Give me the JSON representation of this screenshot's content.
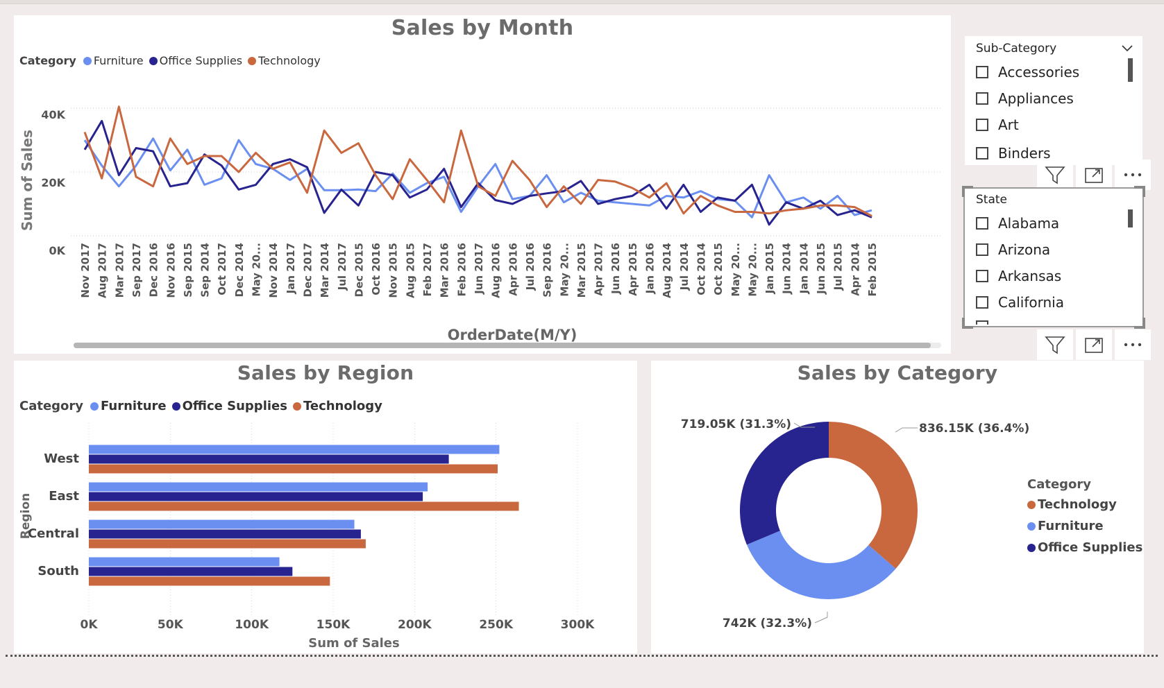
{
  "colors": {
    "furniture": "#6b8ff0",
    "office_supplies": "#27238f",
    "technology": "#c9683f"
  },
  "month_chart": {
    "title": "Sales by Month",
    "legend_label": "Category",
    "legend": [
      "Furniture",
      "Office Supplies",
      "Technology"
    ],
    "ylabel": "Sum of Sales",
    "xlabel": "OrderDate(M/Y)",
    "y_ticks": [
      "40K",
      "20K",
      "0K"
    ]
  },
  "region_chart": {
    "title": "Sales by Region",
    "legend_label": "Category",
    "legend": [
      "Furniture",
      "Office Supplies",
      "Technology"
    ],
    "ylabel": "Region",
    "xlabel": "Sum of Sales",
    "x_ticks": [
      "0K",
      "50K",
      "100K",
      "150K",
      "200K",
      "250K",
      "300K"
    ]
  },
  "category_chart": {
    "title": "Sales by Category",
    "legend_title": "Category",
    "legend": [
      "Technology",
      "Furniture",
      "Office Supplies"
    ],
    "labels": [
      "836.15K (36.4%)",
      "742K (32.3%)",
      "719.05K (31.3%)"
    ]
  },
  "slicers": {
    "subcategory": {
      "header": "Sub-Category",
      "items": [
        "Accessories",
        "Appliances",
        "Art",
        "Binders"
      ]
    },
    "state": {
      "header": "State",
      "items": [
        "Alabama",
        "Arizona",
        "Arkansas",
        "California"
      ]
    }
  },
  "chart_data": [
    {
      "type": "line",
      "title": "Sales by Month",
      "xlabel": "OrderDate(M/Y)",
      "ylabel": "Sum of Sales",
      "ylim": [
        0,
        45000
      ],
      "grid": true,
      "legend_placement": "top-left",
      "categories": [
        "Nov 2017",
        "Aug 2017",
        "Mar 2017",
        "Sep 2017",
        "Dec 2016",
        "Nov 2016",
        "Sep 2015",
        "Sep 2014",
        "Oct 2017",
        "Dec 2014",
        "May 20...",
        "Nov 2014",
        "Jan 2017",
        "Dec 2017",
        "Mar 2014",
        "Jul 2017",
        "Dec 2015",
        "Oct 2016",
        "Nov 2015",
        "Aug 2015",
        "Feb 2017",
        "Mar 2016",
        "Feb 2016",
        "Jun 2017",
        "Aug 2016",
        "Apr 2016",
        "Jul 2016",
        "Sep 2016",
        "May 20...",
        "Mar 2015",
        "Apr 2017",
        "Jun 2016",
        "Apr 2015",
        "Jan 2016",
        "Aug 2014",
        "Jul 2014",
        "Oct 2014",
        "Oct 2015",
        "May 20...",
        "May 20...",
        "Jan 2015",
        "Jun 2014",
        "Jan 2014",
        "Jun 2015",
        "Jul 2015",
        "Apr 2014",
        "Feb 2015"
      ],
      "series": [
        {
          "name": "Furniture",
          "values": [
            30000,
            22000,
            15500,
            22000,
            30500,
            20500,
            27000,
            16000,
            18000,
            30000,
            22500,
            21000,
            17500,
            21000,
            14300,
            14300,
            14500,
            14000,
            19500,
            13500,
            16500,
            18500,
            7500,
            15500,
            22500,
            11500,
            12500,
            19000,
            10500,
            13500,
            11000,
            10500,
            10000,
            9500,
            12500,
            12000,
            14000,
            11500,
            11000,
            5800,
            19000,
            10500,
            12000,
            8500,
            12500,
            6500,
            8000
          ]
        },
        {
          "name": "Office Supplies",
          "values": [
            27000,
            36000,
            19000,
            27500,
            26500,
            15500,
            16500,
            25500,
            22000,
            14500,
            16000,
            22500,
            24000,
            21500,
            7200,
            14500,
            9500,
            20000,
            19000,
            12000,
            14500,
            21000,
            9000,
            16500,
            11200,
            10000,
            12500,
            13300,
            14000,
            17200,
            10000,
            11500,
            12500,
            16000,
            8500,
            16000,
            7500,
            12000,
            11000,
            16000,
            3500,
            10500,
            8500,
            11000,
            6500,
            8000,
            5800
          ]
        },
        {
          "name": "Technology",
          "values": [
            32500,
            18000,
            40500,
            18500,
            15500,
            30500,
            22500,
            25000,
            25000,
            20000,
            26000,
            21000,
            23000,
            13500,
            33000,
            26000,
            29000,
            19000,
            11500,
            24000,
            17500,
            10500,
            33000,
            15500,
            12500,
            23500,
            17500,
            9000,
            15500,
            10000,
            17500,
            17000,
            15000,
            12000,
            16500,
            7000,
            12500,
            9500,
            7500,
            7500,
            7000,
            8000,
            8500,
            9500,
            9500,
            9000,
            6200
          ]
        }
      ]
    },
    {
      "type": "bar",
      "title": "Sales by Region",
      "orientation": "horizontal",
      "xlabel": "Sum of Sales",
      "ylabel": "Region",
      "xlim": [
        0,
        300000
      ],
      "categories": [
        "West",
        "East",
        "Central",
        "South"
      ],
      "series": [
        {
          "name": "Furniture",
          "values": [
            252000,
            208000,
            163000,
            117000
          ]
        },
        {
          "name": "Office Supplies",
          "values": [
            221000,
            205000,
            167000,
            125000
          ]
        },
        {
          "name": "Technology",
          "values": [
            251000,
            264000,
            170000,
            148000
          ]
        }
      ]
    },
    {
      "type": "pie",
      "subtype": "donut",
      "title": "Sales by Category",
      "categories": [
        "Technology",
        "Furniture",
        "Office Supplies"
      ],
      "values": [
        836150,
        742000,
        719050
      ],
      "percent": [
        36.4,
        32.3,
        31.3
      ],
      "legend_placement": "right"
    }
  ]
}
